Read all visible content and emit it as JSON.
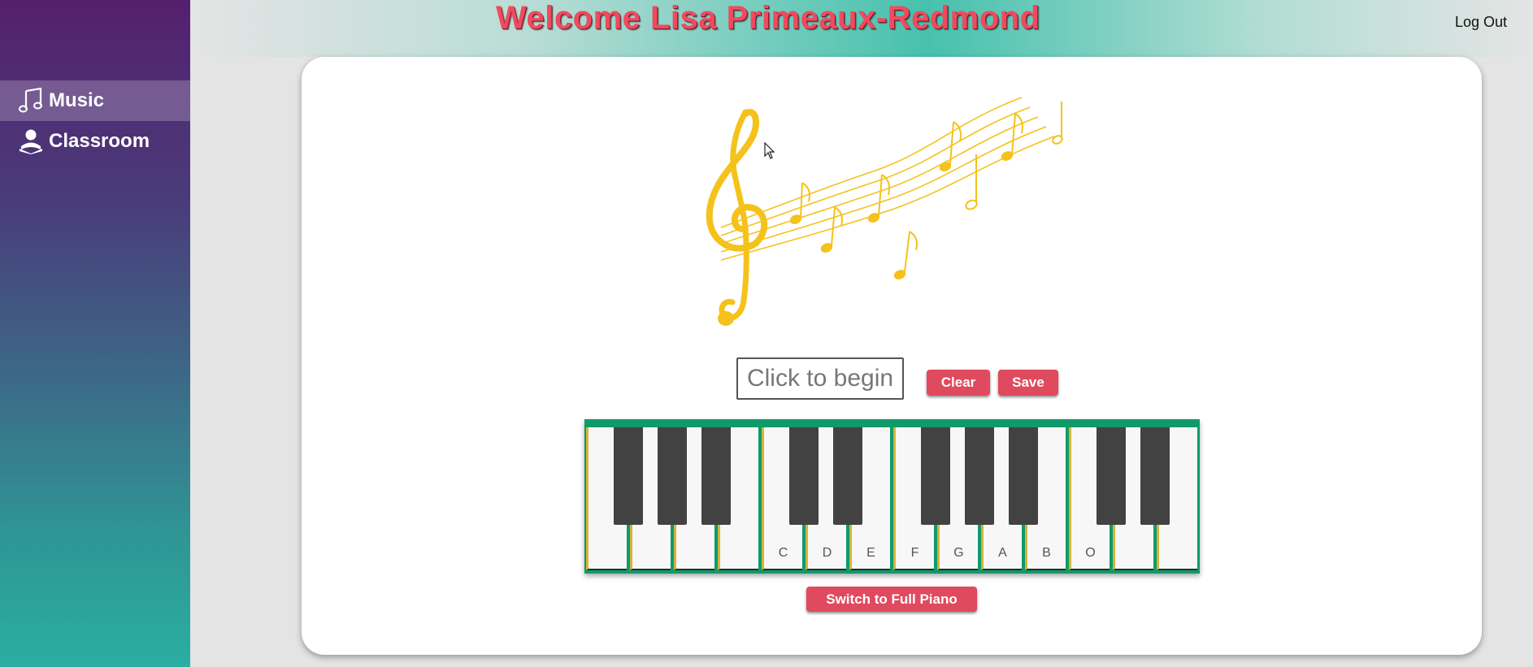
{
  "sidebar": {
    "items": [
      {
        "label": "Music",
        "icon": "music-note-icon",
        "active": true
      },
      {
        "label": "Classroom",
        "icon": "person-reading-icon",
        "active": false
      }
    ]
  },
  "header": {
    "welcome": "Welcome Lisa Primeaux-Redmond",
    "logout": "Log Out"
  },
  "composer": {
    "output_placeholder": "Click to begin",
    "clear_label": "Clear",
    "save_label": "Save",
    "switch_label": "Switch to Full Piano"
  },
  "piano": {
    "white_keys": [
      "",
      "",
      "",
      "",
      "C",
      "D",
      "E",
      "F",
      "G",
      "A",
      "B",
      "O",
      "",
      ""
    ],
    "black_key_count": 10
  },
  "colors": {
    "accent_red": "#e04a5e",
    "piano_frame": "#0f9a6a",
    "clef_gold": "#f5c21b"
  }
}
